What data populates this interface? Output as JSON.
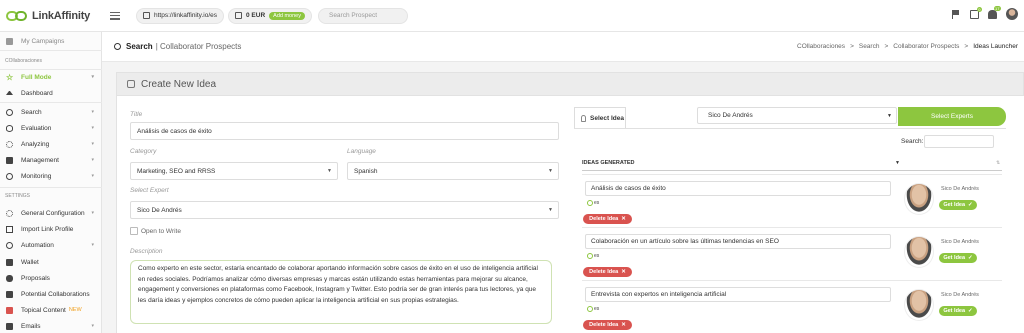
{
  "topbar": {
    "logo_text": "LinkAffinity",
    "url": "https://linkaffinity.io/es",
    "balance": "0 EUR",
    "add_money": "Add money",
    "search_placeholder": "Search Prospect",
    "cart_count": "0",
    "notif_count": "17"
  },
  "sidebar": {
    "my_campaigns": "My Campaigns",
    "section_collab": "COllaboraciones",
    "full_mode": "Full Mode",
    "dashboard": "Dashboard",
    "search": "Search",
    "evaluation": "Evaluation",
    "analyzing": "Analyzing",
    "management": "Management",
    "monitoring": "Monitoring",
    "section_settings": "SETTINGS",
    "general_configuration": "General Configuration",
    "import_link_profile": "Import Link Profile",
    "automation": "Automation",
    "wallet": "Wallet",
    "proposals": "Proposals",
    "potential_collaborations": "Potential Collaborations",
    "topical_content": "Topical Content",
    "new_tag": "NEW",
    "emails": "Emails"
  },
  "header": {
    "title": "Search",
    "subtitle": "| Collaborator Prospects",
    "breadcrumb": [
      "COllaboraciones",
      ">",
      "Search",
      ">",
      "Collaborator Prospects",
      ">",
      "Ideas Launcher"
    ]
  },
  "form": {
    "card_title": "Create New Idea",
    "title_label": "Title",
    "title_value": "Análisis de casos de éxito",
    "category_label": "Category",
    "category_value": "Marketing, SEO and RRSS",
    "language_label": "Language",
    "language_value": "Spanish",
    "expert_label": "Select Expert",
    "expert_value": "Sico De Andrés",
    "open_to_write": "Open to Write",
    "description_label": "Description",
    "description_value": "Como experto en este sector, estaría encantado de colaborar aportando información sobre casos de éxito en el uso de inteligencia artificial en redes sociales. Podríamos analizar cómo diversas empresas y marcas están utilizando estas herramientas para mejorar su alcance, engagement y conversiones en plataformas como Facebook, Instagram y Twitter. Esto podría ser de gran interés para tus lectores, ya que les daría ideas y ejemplos concretos de cómo pueden aplicar la inteligencia artificial en sus propias estrategias."
  },
  "ideas_panel": {
    "tab_label": "Select Idea",
    "expert_select": "Sico De Andrés",
    "select_experts_button": "Select Experts",
    "search_label": "Search:",
    "column_header": "IDEAS GENERATED",
    "delete_label": "Delete Idea",
    "get_idea_label": "Get Idea",
    "es_label": "es",
    "rows": [
      {
        "title": "Análisis de casos de éxito",
        "expert": "Sico De Andrés"
      },
      {
        "title": "Colaboración en un artículo sobre las últimas tendencias en SEO",
        "expert": "Sico De Andrés"
      },
      {
        "title": "Entrevista con expertos en inteligencia artificial",
        "expert": "Sico De Andrés"
      }
    ]
  }
}
